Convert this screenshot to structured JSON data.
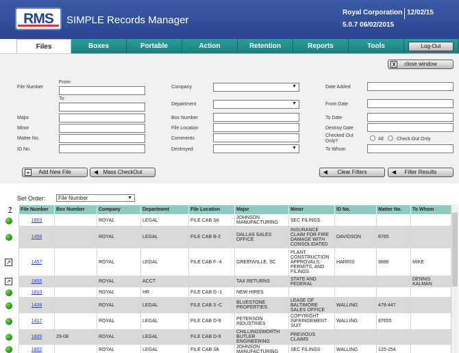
{
  "header": {
    "logo": "RMS",
    "title": "SIMPLE Records Manager",
    "organization": "Royal Corporation",
    "date": "12/02/15",
    "version": "5.0.7 06/02/2015"
  },
  "tabs": [
    {
      "label": "Files"
    },
    {
      "label": "Boxes"
    },
    {
      "label": "Portable"
    },
    {
      "label": "Action"
    },
    {
      "label": "Retention"
    },
    {
      "label": "Reports"
    },
    {
      "label": "Tools"
    }
  ],
  "logout_label": "Log-Out",
  "close_window_label": "close window",
  "close_window_icon": "X",
  "filters": {
    "file_number": "File Number",
    "from": "From:",
    "to": "To:",
    "major": "Major",
    "minor": "Minor",
    "matter_no": "Matter No.",
    "id_no": "ID No.",
    "company": "Company",
    "department": "Department",
    "box_number": "Box Number",
    "file_location": "File Location",
    "comments": "Comments",
    "destroyed": "Destroyed",
    "date_added": "Date Added",
    "from_date": "From Date",
    "to_date": "To Date",
    "destroy_date": "Destroy Date",
    "checked_out_only": "Checked Out Only?",
    "all": "All",
    "check_out_only": "Check Out Only",
    "to_whom": "To Whom"
  },
  "buttons": {
    "add_new_file": "Add New File",
    "add_icon": "+",
    "mass_checkout": "Mass CheckOut",
    "clear_filters": "Clear Filters",
    "filter_results": "Filter Results"
  },
  "set_order": {
    "label": "Set Order:",
    "value": "File Number"
  },
  "table": {
    "help": "?",
    "columns": [
      "File Number",
      "Box Number",
      "Company",
      "Department",
      "File Location",
      "Major",
      "Minor",
      "ID No.",
      "Matter No.",
      "To Whom"
    ],
    "rows": [
      {
        "status": "green",
        "cells": [
          "1803",
          "",
          "ROYAL",
          "LEGAL",
          "FILE CAB 3A",
          "JOHNSON MANUFACTURING",
          "SEC FILINGS",
          "",
          "",
          ""
        ]
      },
      {
        "status": "green",
        "cells": [
          "1458",
          "",
          "ROYAL",
          "LEGAL",
          "FILE CAB B-2",
          "DALLAS SALES OFFICE",
          "INSURANCE CLAIM FOR FIRE DAMAGE WITH CONSOLIDATED",
          "DAVIDSON",
          "8765",
          ""
        ]
      },
      {
        "status": "checkout",
        "cells": [
          "1457",
          "",
          "ROYAL",
          "LEGAL",
          "FILE CAB F -4",
          "GREENVILLE, SC",
          "PLANT CONSTRUCTION APPROVALS, PERMITS, AND FILINGS",
          "HARRIS",
          "9888",
          "MIKE"
        ]
      },
      {
        "status": "checkout",
        "cells": [
          "1805",
          "",
          "ROYAL",
          "ACCT",
          "",
          "TAX RETURNS",
          "STATE AND FEDERAL",
          "",
          "",
          "DENNIS KALMAN"
        ]
      },
      {
        "status": "green",
        "cells": [
          "1810",
          "",
          "ROYAL",
          "HR",
          "FILE CAB D -1",
          "NEW HIRES",
          "",
          "",
          "",
          ""
        ]
      },
      {
        "status": "green",
        "cells": [
          "1438",
          "",
          "ROYAL",
          "LEGAL",
          "FILE CAB 3 -C",
          "BLUESTONE PROPERTIES",
          "LEASE OF BALTIMORE SALES OFFICE",
          "WALLING",
          "478-447",
          ""
        ]
      },
      {
        "status": "green",
        "cells": [
          "1417",
          "",
          "ROYAL",
          "LEGAL",
          "FILE CAB D-9",
          "PETERSON INDUSTRIES",
          "COPYRIGHT INFRINGEMENT SUIT",
          "WALLING",
          "87655",
          ""
        ]
      },
      {
        "status": "green",
        "cells": [
          "1809",
          "29-08",
          "ROYAL",
          "LEGAL",
          "FILE CAB D-9",
          "CHILLINGSWORTH BUTLER ENGINEERING",
          "PREVIOUS CLAIMS",
          "",
          "",
          ""
        ]
      },
      {
        "status": "green",
        "cells": [
          "1802",
          "",
          "ROYAL",
          "LEGAL",
          "FILE CAB 3A",
          "JOHNSON MANUFACTURING",
          "SEC FILINGS",
          "WALLING",
          "125-254",
          ""
        ]
      }
    ]
  }
}
